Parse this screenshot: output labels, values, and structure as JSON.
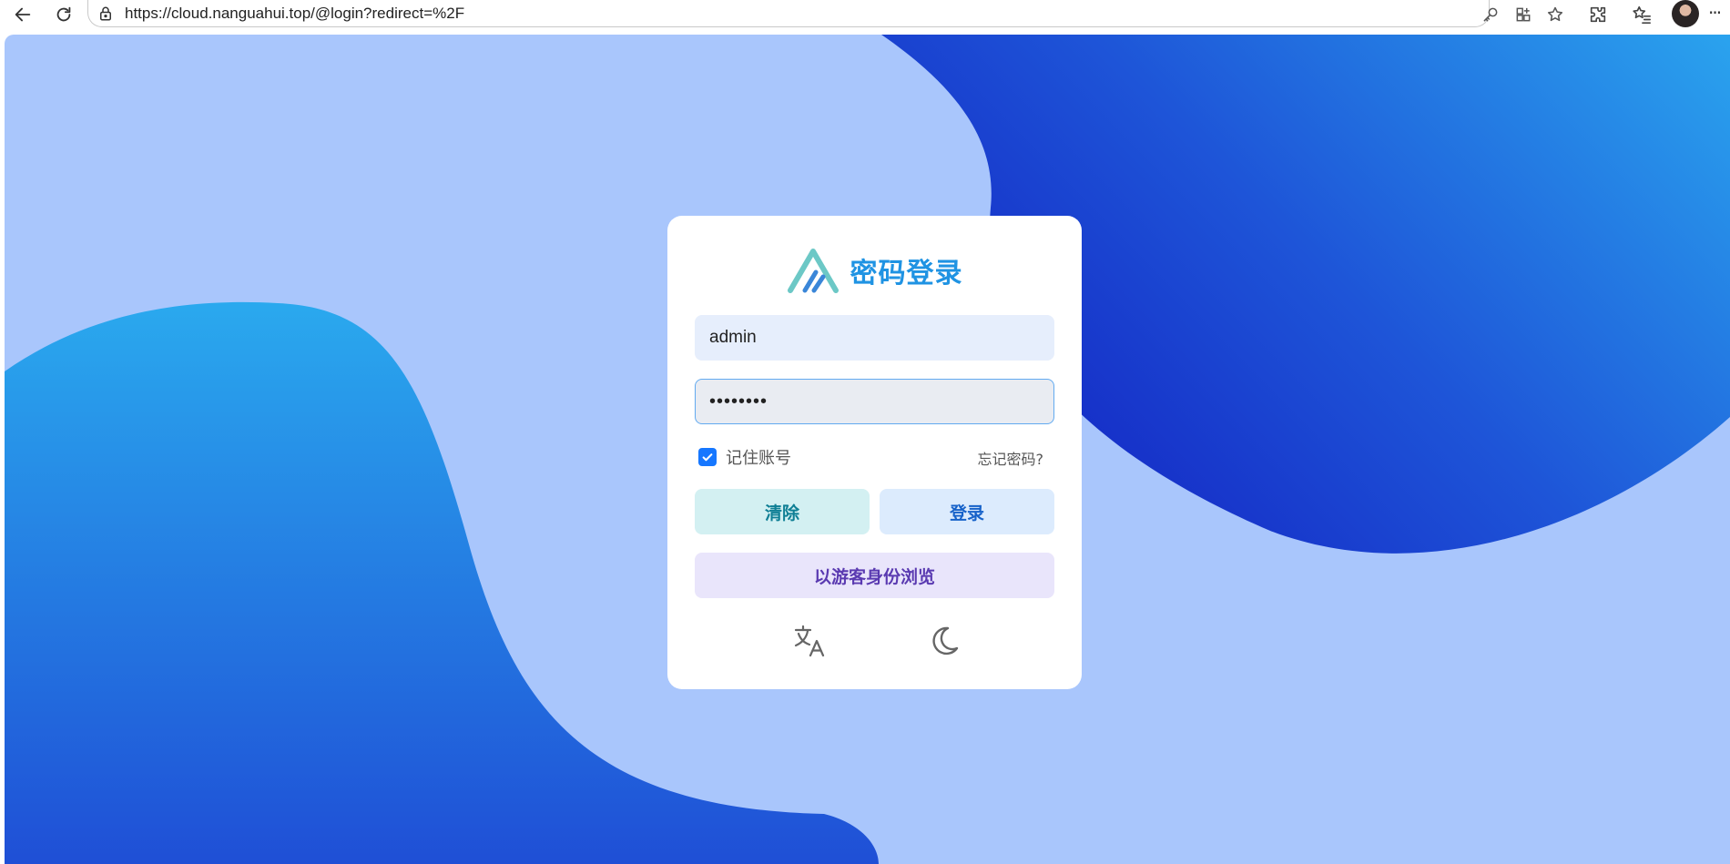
{
  "browser": {
    "url": "https://cloud.nanguahui.top/@login?redirect=%2F",
    "more_label": "···"
  },
  "login": {
    "title": "密码登录",
    "username_value": "admin",
    "password_value": "••••••••",
    "remember_label": "记住账号",
    "remember_checked": true,
    "forgot_label": "忘记密码?",
    "clear_label": "清除",
    "login_label": "登录",
    "guest_label": "以游客身份浏览"
  },
  "icons": {
    "back": "back-arrow-icon",
    "refresh": "refresh-icon",
    "lock": "lock-icon",
    "key": "key-icon",
    "apps": "add-app-icon",
    "favorite": "star-icon",
    "extensions": "puzzle-icon",
    "favorites_list": "favorites-icon",
    "logo": "logo-icon",
    "translate": "translate-icon",
    "dark_mode": "moon-icon"
  },
  "colors": {
    "page_background": "#a9c6fc",
    "title": "#1f93e3",
    "checkbox": "#1677ff",
    "clear_button_bg": "#d3f0f2",
    "login_button_bg": "#dcebfd",
    "guest_button_bg": "#e9e5fb"
  }
}
